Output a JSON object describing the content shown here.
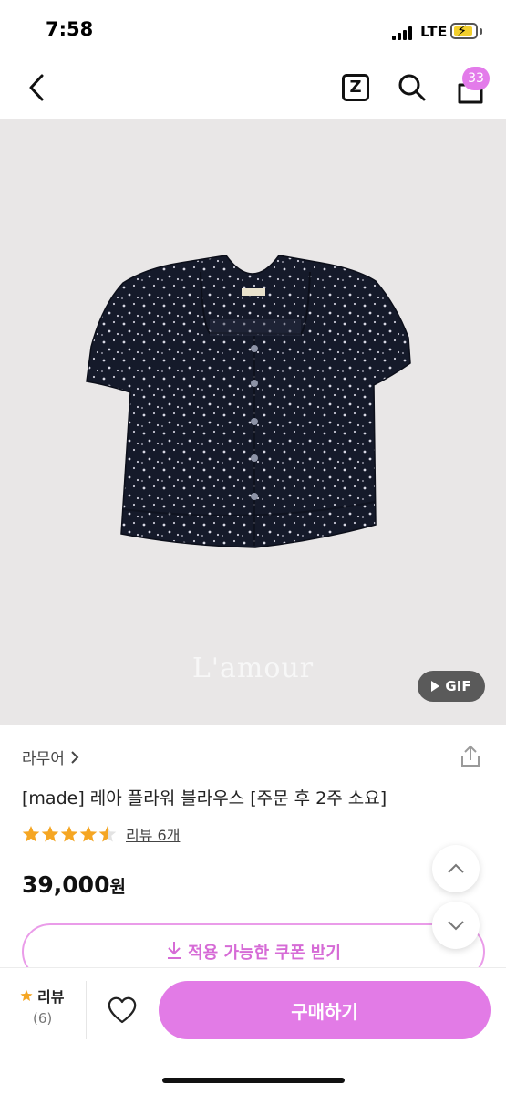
{
  "status_bar": {
    "time": "7:58",
    "network": "LTE"
  },
  "nav": {
    "back_icon": "chevron-left-icon",
    "z_label": "Z",
    "search_icon": "search-icon",
    "cart_icon": "shopping-bag-icon",
    "cart_badge": "33"
  },
  "product": {
    "image_watermark": "L'amour",
    "gif_label": "GIF",
    "brand": "라무어",
    "title": "[made] 레아 플라워 블라우스 [주문 후 2주 소요]",
    "rating": 4.5,
    "review_link": "리뷰 6개",
    "price": "39,000",
    "price_unit": "원"
  },
  "coupon": {
    "label": "적용 가능한 쿠폰 받기"
  },
  "bottom_bar": {
    "review_label": "리뷰",
    "review_count": "(6)",
    "buy_label": "구매하기"
  },
  "colors": {
    "accent": "#e27be6",
    "coupon_text": "#d66bd6",
    "star": "#f5a623",
    "image_bg": "#e9e7e7"
  }
}
